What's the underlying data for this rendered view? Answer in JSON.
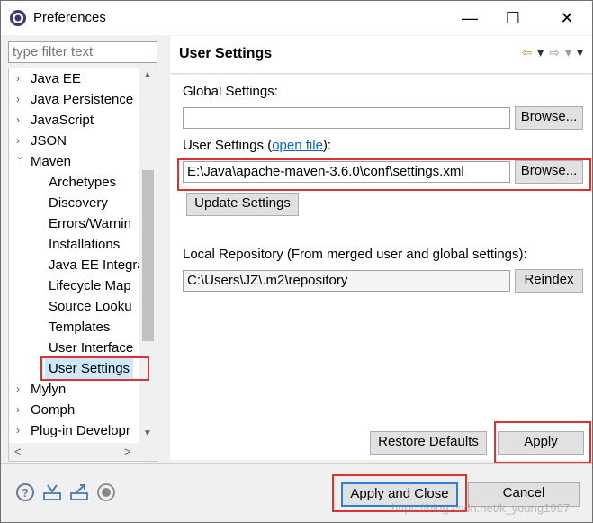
{
  "window": {
    "title": "Preferences",
    "minimize": "—",
    "maximize": "☐",
    "close": "✕"
  },
  "filter": {
    "placeholder": "type filter text"
  },
  "tree": {
    "items": [
      {
        "label": "Java EE",
        "expanded": false
      },
      {
        "label": "Java Persistence",
        "expanded": false
      },
      {
        "label": "JavaScript",
        "expanded": false
      },
      {
        "label": "JSON",
        "expanded": false
      },
      {
        "label": "Maven",
        "expanded": true
      },
      {
        "label": "Archetypes"
      },
      {
        "label": "Discovery"
      },
      {
        "label": "Errors/Warnin"
      },
      {
        "label": "Installations"
      },
      {
        "label": "Java EE Integra"
      },
      {
        "label": "Lifecycle Map"
      },
      {
        "label": "Source Looku"
      },
      {
        "label": "Templates"
      },
      {
        "label": "User Interface"
      },
      {
        "label": "User Settings",
        "selected": true
      },
      {
        "label": "Mylyn",
        "expanded": false
      },
      {
        "label": "Oomph",
        "expanded": false
      },
      {
        "label": "Plug-in Developr",
        "expanded": false
      }
    ]
  },
  "page": {
    "title": "User Settings",
    "global_settings_label": "Global Settings:",
    "global_settings_value": "",
    "browse_label": "Browse...",
    "user_settings_label": "User Settings (",
    "open_file_link": "open file",
    "user_settings_label_end": "):",
    "user_settings_value": "E:\\Java\\apache-maven-3.6.0\\conf\\settings.xml",
    "update_settings_label": "Update Settings",
    "local_repo_label": "Local Repository (From merged user and global settings):",
    "local_repo_value": "C:\\Users\\JZ\\.m2\\repository",
    "reindex_label": "Reindex",
    "restore_defaults_label": "Restore Defaults",
    "apply_label": "Apply"
  },
  "footer": {
    "apply_close_label": "Apply and Close",
    "cancel_label": "Cancel",
    "watermark": "https://blog.csdn.net/k_young1997"
  },
  "colors": {
    "highlight_box": "#e03030",
    "selection": "#cce8ff",
    "link": "#0066cc"
  }
}
